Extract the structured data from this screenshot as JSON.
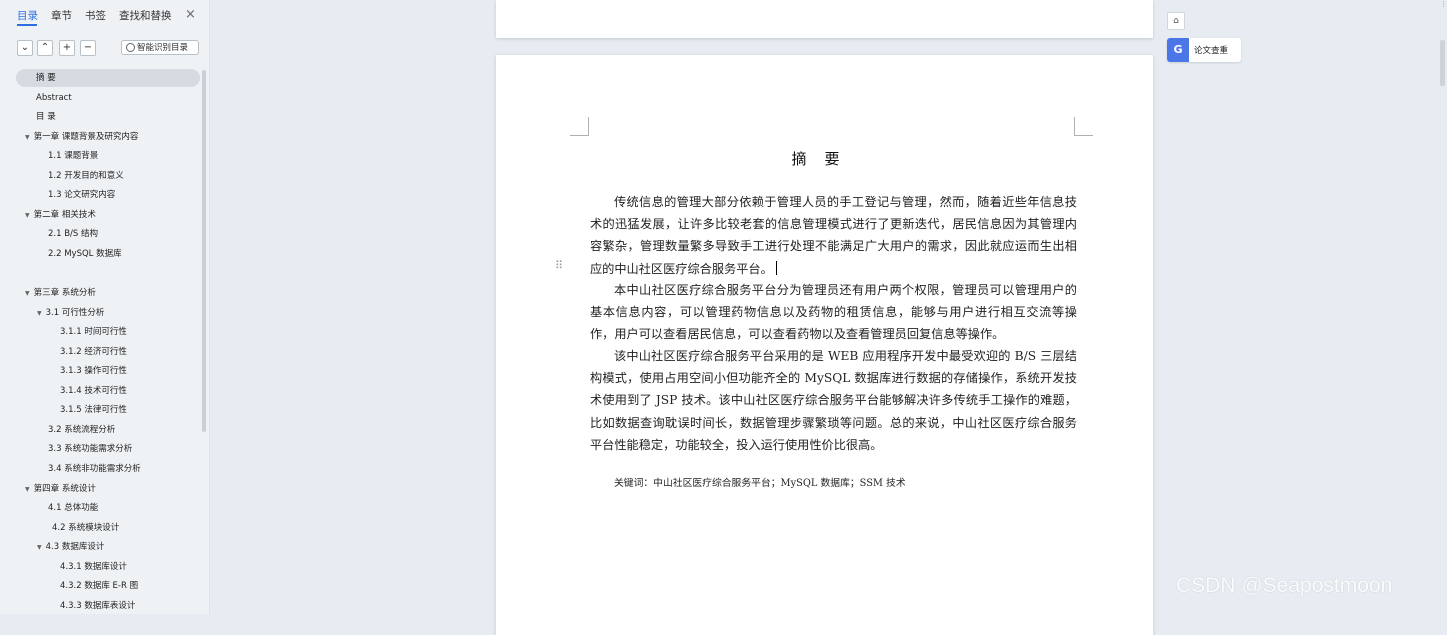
{
  "sidebar": {
    "tabs": [
      {
        "label": "目录",
        "active": true
      },
      {
        "label": "章节"
      },
      {
        "label": "书签"
      },
      {
        "label": "查找和替换"
      }
    ],
    "close_icon": "×",
    "tools": {
      "collapse": "⌄",
      "expand": "⌃",
      "add": "+",
      "remove": "−",
      "smart_label": "智能识别目录"
    },
    "toc": [
      {
        "label": "摘    要",
        "level": 0,
        "selected": true
      },
      {
        "label": "Abstract",
        "level": 0
      },
      {
        "label": "目    录",
        "level": 0
      },
      {
        "label": "第一章  课题背景及研究内容",
        "level": 0,
        "arrow": true
      },
      {
        "label": "1.1 课题背景",
        "level": 1
      },
      {
        "label": "1.2 开发目的和意义",
        "level": 1
      },
      {
        "label": "1.3 论文研究内容",
        "level": 1
      },
      {
        "label": "第二章 相关技术",
        "level": 0,
        "arrow": true
      },
      {
        "label": "2.1 B/S 结构",
        "level": 1
      },
      {
        "label": "2.2 MySQL 数据库",
        "level": 1
      },
      {
        "label": "第三章 系统分析",
        "level": 0,
        "arrow": true
      },
      {
        "label": "3.1 可行性分析",
        "level": 1,
        "arrow": true
      },
      {
        "label": "3.1.1 时间可行性",
        "level": 2
      },
      {
        "label": "3.1.2 经济可行性",
        "level": 2
      },
      {
        "label": "3.1.3 操作可行性",
        "level": 2
      },
      {
        "label": "3.1.4 技术可行性",
        "level": 2
      },
      {
        "label": "3.1.5 法律可行性",
        "level": 2
      },
      {
        "label": "3.2 系统流程分析",
        "level": 1
      },
      {
        "label": "3.3 系统功能需求分析",
        "level": 1
      },
      {
        "label": "3.4 系统非功能需求分析",
        "level": 1
      },
      {
        "label": "第四章 系统设计",
        "level": 0,
        "arrow": true
      },
      {
        "label": "4.1 总体功能",
        "level": 1
      },
      {
        "label": "4.2 系统模块设计",
        "level": 1
      },
      {
        "label": "4.3 数据库设计",
        "level": 1,
        "arrow": true
      },
      {
        "label": "4.3.1 数据库设计",
        "level": 2
      },
      {
        "label": "4.3.2 数据库 E-R 图",
        "level": 2
      },
      {
        "label": "4.3.3 数据库表设计",
        "level": 2
      }
    ]
  },
  "document": {
    "title": "摘要",
    "paragraphs": [
      "传统信息的管理大部分依赖于管理人员的手工登记与管理，然而，随着近些年信息技术的迅猛发展，让许多比较老套的信息管理模式进行了更新迭代，居民信息因为其管理内容繁杂，管理数量繁多导致手工进行处理不能满足广大用户的需求，因此就应运而生出相应的中山社区医疗综合服务平台。",
      "本中山社区医疗综合服务平台分为管理员还有用户两个权限，管理员可以管理用户的基本信息内容，可以管理药物信息以及药物的租赁信息，能够与用户进行相互交流等操作，用户可以查看居民信息，可以查看药物以及查看管理员回复信息等操作。",
      "该中山社区医疗综合服务平台采用的是 WEB 应用程序开发中最受欢迎的 B/S 三层结构模式，使用占用空间小但功能齐全的 MySQL 数据库进行数据的存储操作，系统开发技术使用到了 JSP 技术。该中山社区医疗综合服务平台能够解决许多传统手工操作的难题，比如数据查询耽误时间长，数据管理步骤繁琐等问题。总的来说，中山社区医疗综合服务平台性能稳定，功能较全，投入运行使用性价比很高。"
    ],
    "keywords": "关键词：中山社区医疗综合服务平台；MySQL 数据库；SSM 技术",
    "drag_handle": "⠿"
  },
  "right_panel": {
    "collapse_icon": "⌂",
    "plagiarism_icon": "G",
    "plagiarism_label": "论文查重"
  },
  "watermark": "CSDN @Seapostmoon"
}
